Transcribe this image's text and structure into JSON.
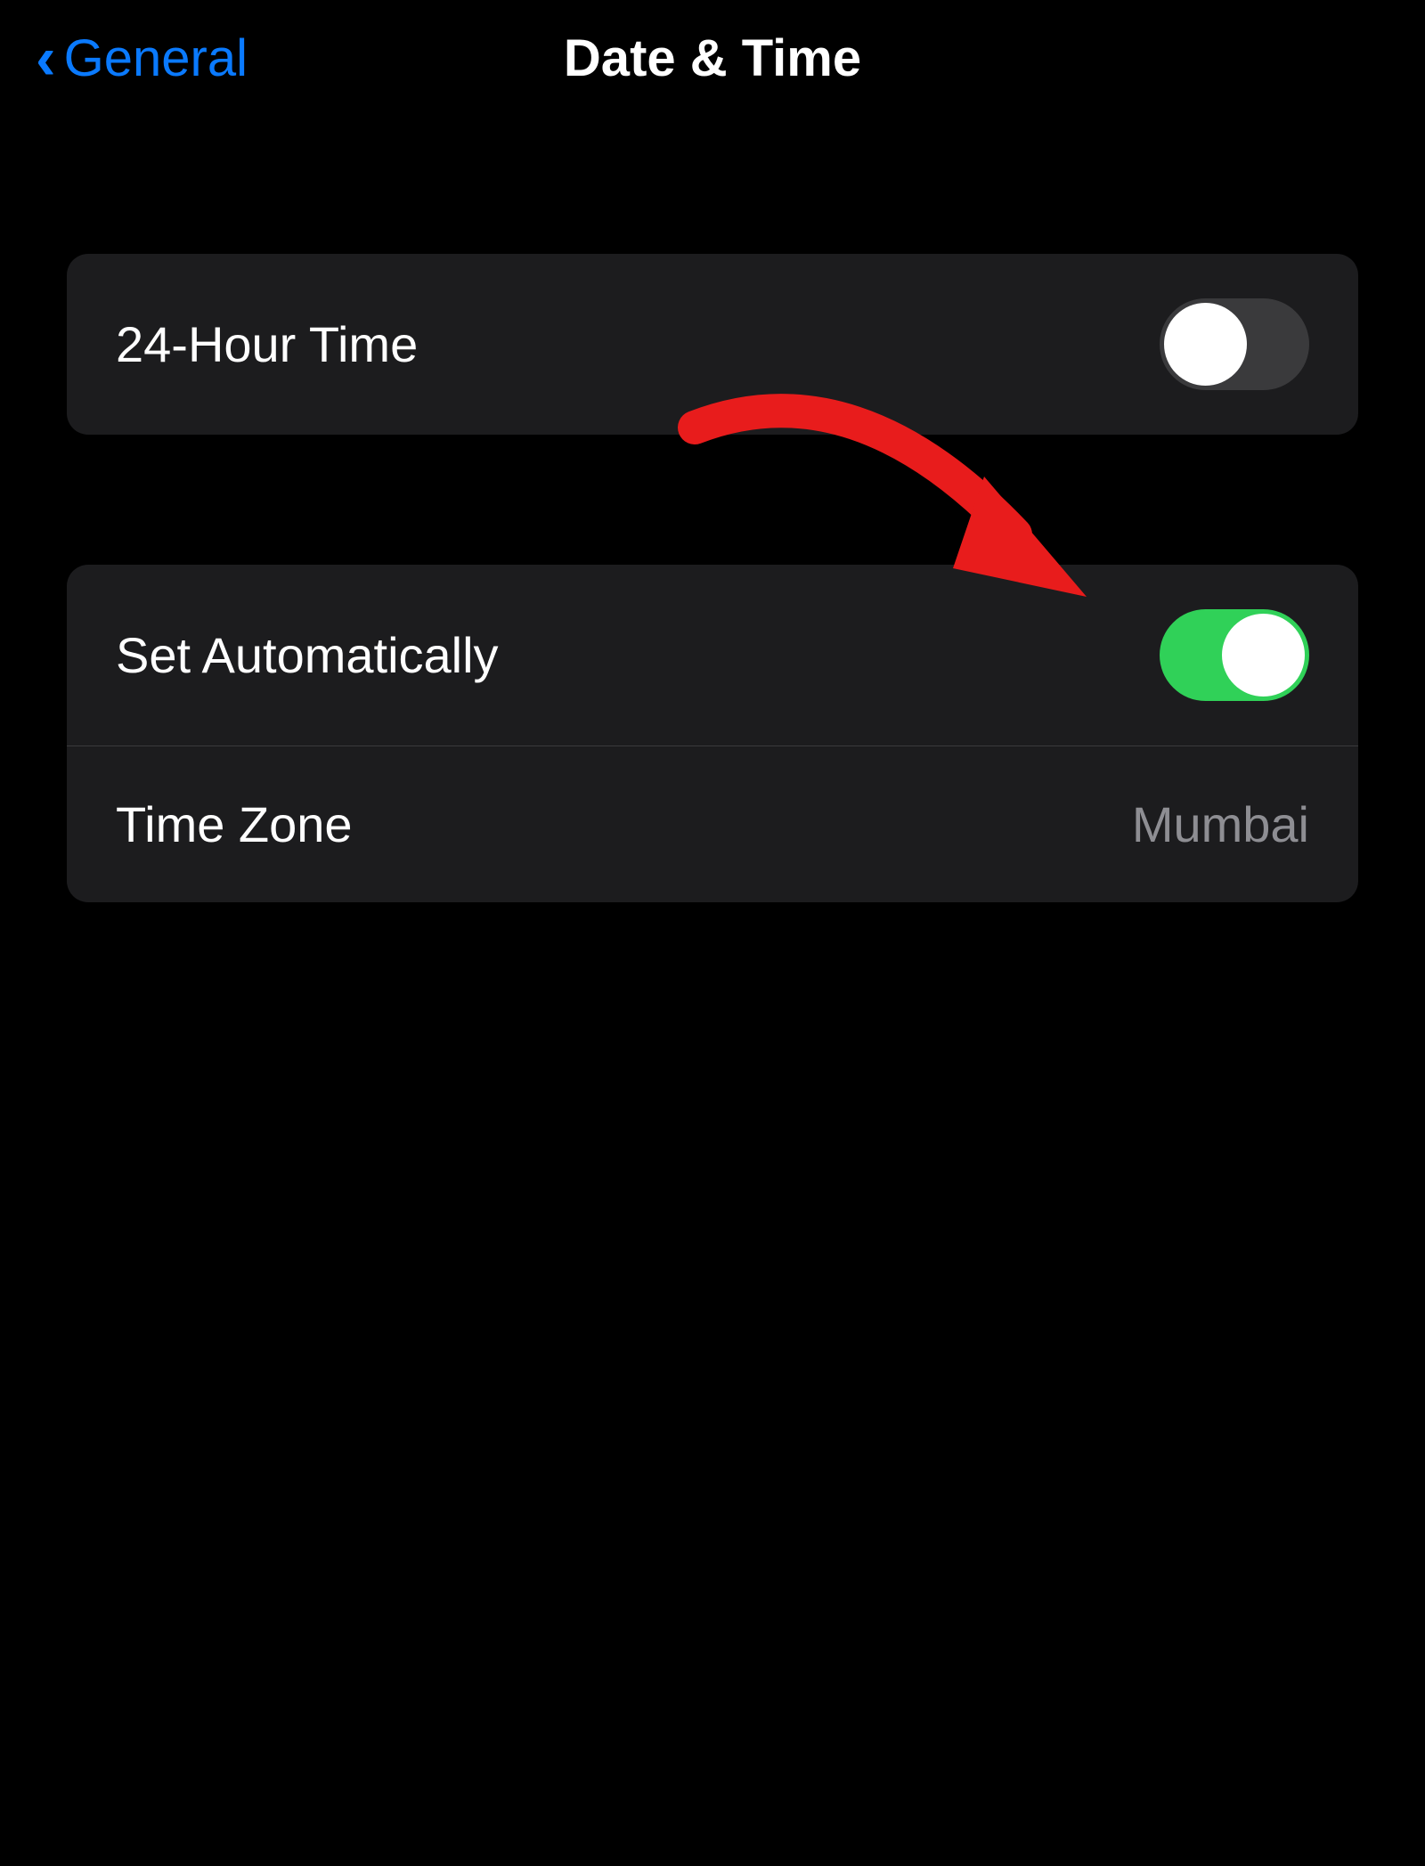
{
  "header": {
    "back_label": "General",
    "title": "Date & Time"
  },
  "settings": {
    "group1": {
      "rows": [
        {
          "label": "24-Hour Time",
          "toggle_state": "off"
        }
      ]
    },
    "group2": {
      "rows": [
        {
          "label": "Set Automatically",
          "toggle_state": "on"
        },
        {
          "label": "Time Zone",
          "value": "Mumbai"
        }
      ]
    }
  },
  "annotation": {
    "arrow_color": "#ff0000"
  }
}
